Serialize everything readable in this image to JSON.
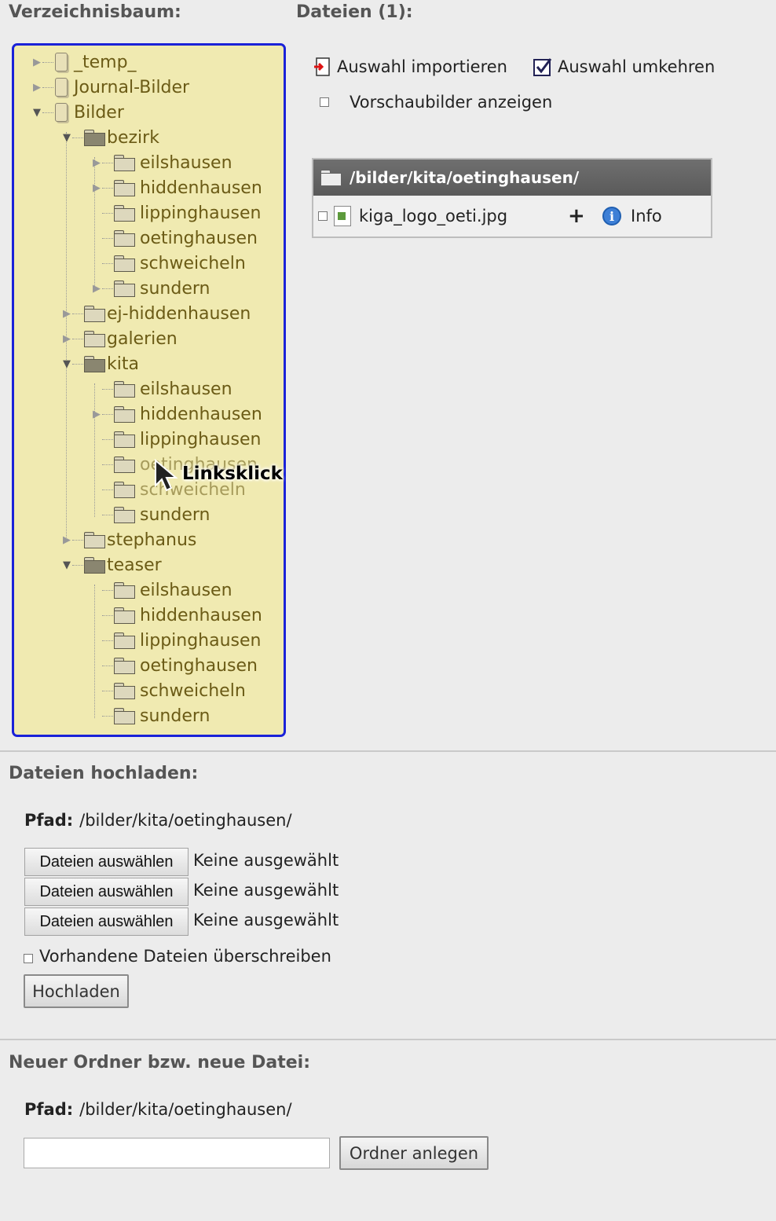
{
  "tree_title": "Verzeichnisbaum:",
  "files_title": "Dateien (1):",
  "tree": {
    "items": [
      {
        "label": "_temp_"
      },
      {
        "label": "Journal-Bilder"
      },
      {
        "label": "Bilder"
      },
      {
        "label": "bezirk"
      },
      {
        "label": "eilshausen"
      },
      {
        "label": "hiddenhausen"
      },
      {
        "label": "lippinghausen"
      },
      {
        "label": "oetinghausen"
      },
      {
        "label": "schweicheln"
      },
      {
        "label": "sundern"
      },
      {
        "label": "ej-hiddenhausen"
      },
      {
        "label": "galerien"
      },
      {
        "label": "kita"
      },
      {
        "label": "eilshausen"
      },
      {
        "label": "hiddenhausen"
      },
      {
        "label": "lippinghausen"
      },
      {
        "label": "oetinghausen"
      },
      {
        "label": "schweicheln"
      },
      {
        "label": "sundern"
      },
      {
        "label": "stephanus"
      },
      {
        "label": "teaser"
      },
      {
        "label": "eilshausen"
      },
      {
        "label": "hiddenhausen"
      },
      {
        "label": "lippinghausen"
      },
      {
        "label": "oetinghausen"
      },
      {
        "label": "schweicheln"
      },
      {
        "label": "sundern"
      }
    ]
  },
  "actions": {
    "import": "Auswahl importieren",
    "invert": "Auswahl umkehren",
    "thumbs": "Vorschaubilder anzeigen"
  },
  "filelist": {
    "path": "/bilder/kita/oetinghausen/",
    "files": [
      {
        "name": "kiga_logo_oeti.jpg",
        "plus": "+",
        "info": "Info"
      }
    ]
  },
  "cursor_callout": "Linksklick",
  "upload": {
    "title": "Dateien hochladen:",
    "path_label": "Pfad:",
    "path": "/bilder/kita/oetinghausen/",
    "choose_label": "Dateien auswählen",
    "none_selected": "Keine ausgewählt",
    "overwrite": "Vorhandene Dateien überschreiben",
    "submit": "Hochladen"
  },
  "newitem": {
    "title": "Neuer Ordner bzw. neue Datei:",
    "path_label": "Pfad:",
    "path": "/bilder/kita/oetinghausen/",
    "input_value": "",
    "submit": "Ordner anlegen"
  }
}
